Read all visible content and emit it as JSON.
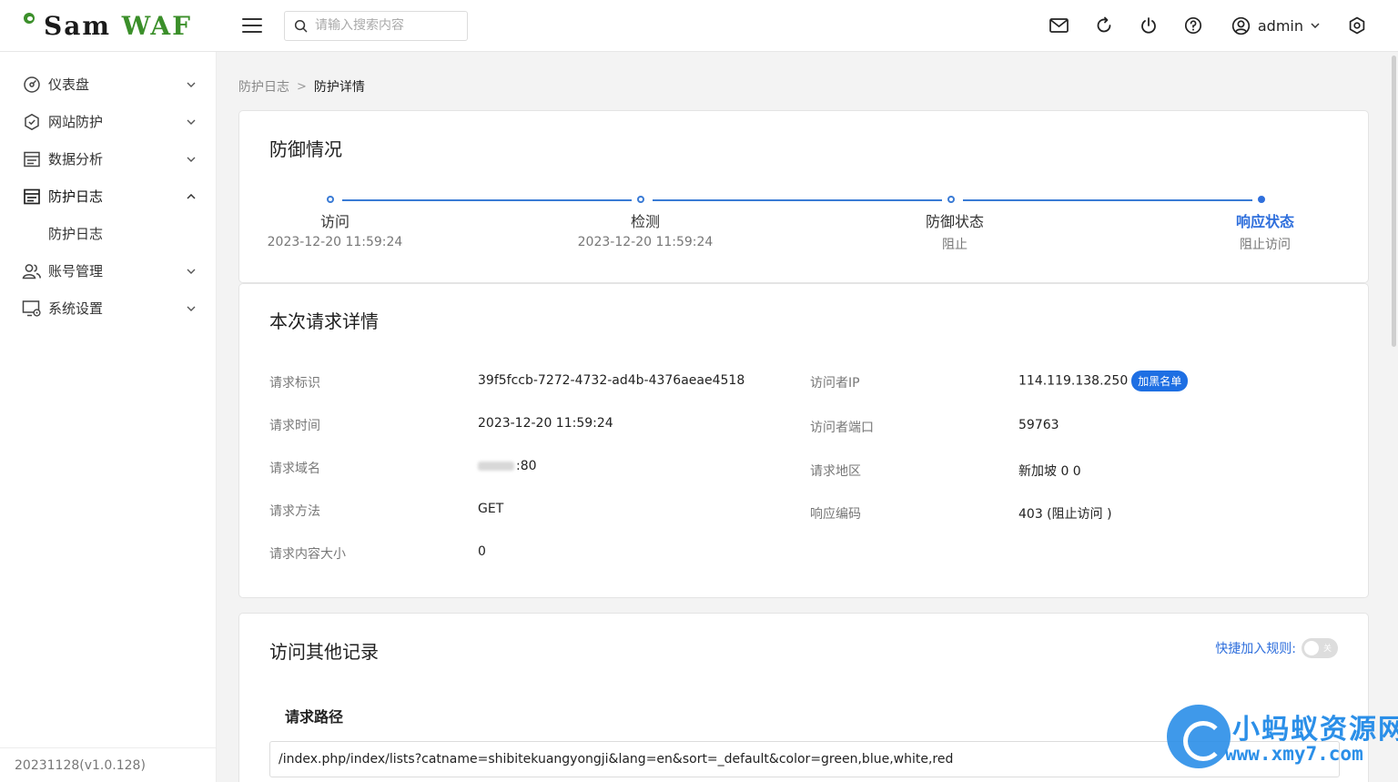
{
  "app": {
    "logo_sam": "Sam",
    "logo_waf": "WAF",
    "brand_color": "#3b8f2a",
    "accent_color": "#2f6fdc"
  },
  "header": {
    "search_placeholder": "请输入搜索内容",
    "user_name": "admin",
    "icons": [
      "mail-icon",
      "refresh-icon",
      "power-icon",
      "help-icon",
      "user-circle-icon",
      "settings-icon"
    ]
  },
  "sidebar": {
    "items": [
      {
        "label": "仪表盘",
        "icon": "dashboard-icon",
        "expanded": false
      },
      {
        "label": "网站防护",
        "icon": "shield-icon",
        "expanded": false
      },
      {
        "label": "数据分析",
        "icon": "analytics-icon",
        "expanded": false
      },
      {
        "label": "防护日志",
        "icon": "log-icon",
        "expanded": true
      },
      {
        "label": "账号管理",
        "icon": "users-icon",
        "expanded": false
      },
      {
        "label": "系统设置",
        "icon": "system-settings-icon",
        "expanded": false
      }
    ],
    "sub_item": "防护日志",
    "version": "20231128(v1.0.128)"
  },
  "breadcrumb": {
    "parent": "防护日志",
    "separator": ">",
    "current": "防护详情"
  },
  "defense": {
    "title": "防御情况",
    "steps": [
      {
        "title": "访问",
        "desc": "2023-12-20 11:59:24"
      },
      {
        "title": "检测",
        "desc": "2023-12-20 11:59:24"
      },
      {
        "title": "防御状态",
        "desc": "阻止"
      },
      {
        "title": "响应状态",
        "desc": "阻止访问"
      }
    ],
    "active_step": 3
  },
  "request": {
    "title": "本次请求详情",
    "left": [
      {
        "label": "请求标识",
        "value": "39f5fccb-7272-4732-ad4b-4376aeae4518"
      },
      {
        "label": "请求时间",
        "value": "2023-12-20 11:59:24"
      },
      {
        "label": "请求域名",
        "value": ":80"
      },
      {
        "label": "请求方法",
        "value": "GET"
      },
      {
        "label": "请求内容大小",
        "value": "0"
      }
    ],
    "right": [
      {
        "label": "访问者IP",
        "value": "114.119.138.250"
      },
      {
        "label": "访问者端口",
        "value": "59763"
      },
      {
        "label": "请求地区",
        "value": "新加坡 0 0"
      },
      {
        "label": "响应编码",
        "value": "403 (阻止访问 )"
      }
    ],
    "blacklist_button": "加黑名单"
  },
  "other": {
    "title": "访问其他记录",
    "quick_add_label": "快捷加入规则:",
    "switch_text": "关",
    "switch_on": false,
    "path_heading": "请求路径",
    "path_value": "/index.php/index/lists?catname=shibitekuangyongji&lang=en&sort=_default&color=green,blue,white,red"
  },
  "watermark": {
    "title": "小蚂蚁资源网",
    "url": "www.xmy7.com"
  }
}
